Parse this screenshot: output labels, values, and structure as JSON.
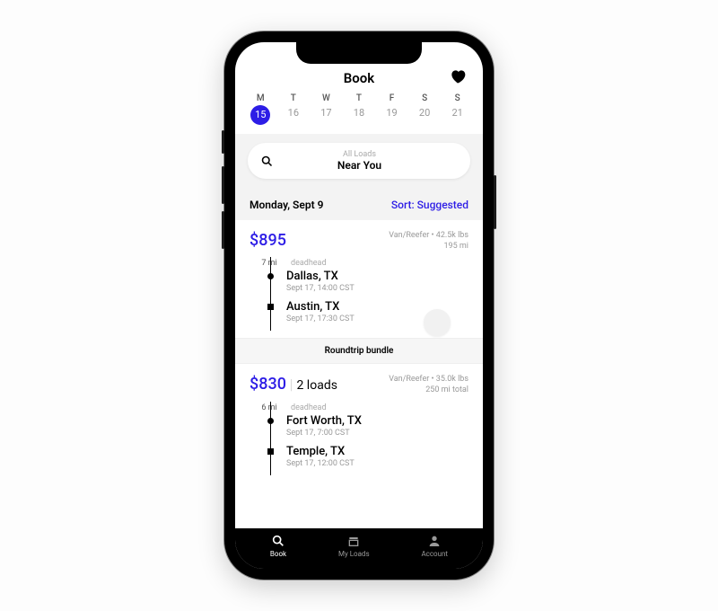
{
  "header": {
    "title": "Book"
  },
  "calendar": {
    "days": [
      {
        "letter": "M",
        "num": "15",
        "selected": true
      },
      {
        "letter": "T",
        "num": "16",
        "selected": false
      },
      {
        "letter": "W",
        "num": "17",
        "selected": false
      },
      {
        "letter": "T",
        "num": "18",
        "selected": false
      },
      {
        "letter": "F",
        "num": "19",
        "selected": false
      },
      {
        "letter": "S",
        "num": "20",
        "selected": false
      },
      {
        "letter": "S",
        "num": "21",
        "selected": false
      }
    ]
  },
  "search": {
    "sub": "All Loads",
    "main": "Near You"
  },
  "date_row": {
    "date": "Monday, Sept 9",
    "sort": "Sort: Suggested"
  },
  "loads": [
    {
      "price": "$895",
      "extra": "",
      "meta1": "Van/Reefer • 42.5k lbs",
      "meta2": "195 mi",
      "deadhead_mi": "7 mi",
      "deadhead_label": "deadhead",
      "stops": [
        {
          "city": "Dallas, TX",
          "time": "Sept 17, 14:00 CST",
          "shape": "circle"
        },
        {
          "city": "Austin, TX",
          "time": "Sept 17, 17:30 CST",
          "shape": "square"
        }
      ]
    },
    {
      "price": "$830",
      "extra": "2 loads",
      "meta1": "Van/Reefer • 35.0k lbs",
      "meta2": "250 mi total",
      "deadhead_mi": "6 mi",
      "deadhead_label": "deadhead",
      "stops": [
        {
          "city": "Fort Worth, TX",
          "time": "Sept 17, 7:00 CST",
          "shape": "circle"
        },
        {
          "city": "Temple, TX",
          "time": "Sept 17, 12:00 CST",
          "shape": "square"
        }
      ]
    }
  ],
  "bundle_label": "Roundtrip bundle",
  "tabs": [
    {
      "label": "Book",
      "active": true
    },
    {
      "label": "My Loads",
      "active": false
    },
    {
      "label": "Account",
      "active": false
    }
  ]
}
